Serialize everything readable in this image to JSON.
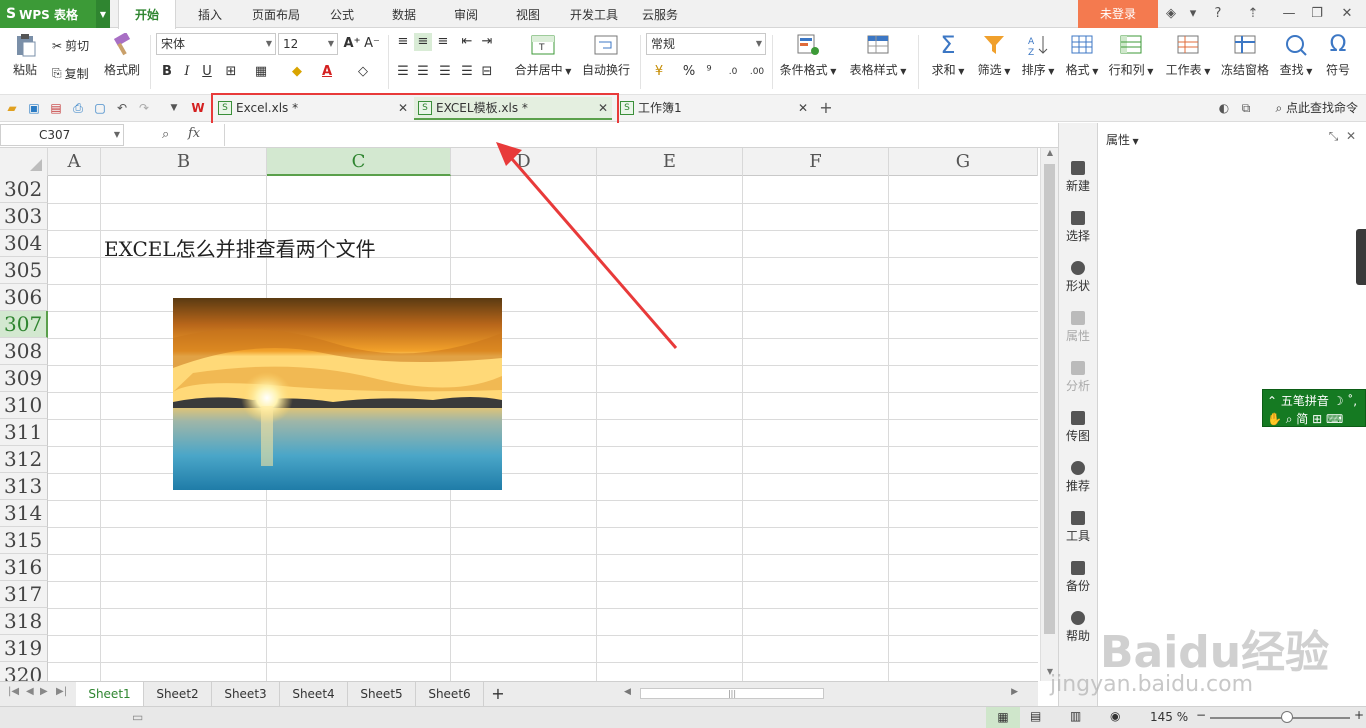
{
  "app": {
    "name": "WPS 表格",
    "login_label": "未登录",
    "help_label": "?"
  },
  "menu": {
    "tabs": [
      "开始",
      "插入",
      "页面布局",
      "公式",
      "数据",
      "审阅",
      "视图",
      "开发工具",
      "云服务"
    ],
    "active_tab": "开始"
  },
  "ribbon": {
    "paste": "粘贴",
    "cut": "剪切",
    "copy": "复制",
    "format_painter": "格式刷",
    "font_name": "宋体",
    "font_size": "12",
    "bold": "B",
    "italic": "I",
    "underline": "U",
    "merge_center": "合并居中",
    "wrap_text": "自动换行",
    "number_format": "常规",
    "percent": "%",
    "thousands": "⁹",
    "cond_format": "条件格式",
    "table_style": "表格样式",
    "sum": "求和",
    "filter": "筛选",
    "sort": "排序",
    "format": "格式",
    "row_col": "行和列",
    "worksheet": "工作表",
    "freeze": "冻结窗格",
    "find": "查找",
    "symbol": "符号"
  },
  "doc_tabs": [
    {
      "name": "Excel.xls *",
      "active": false
    },
    {
      "name": "EXCEL模板.xls *",
      "active": true
    },
    {
      "name": "工作簿1",
      "active": false
    }
  ],
  "find_command": "点此查找命令",
  "formula_bar": {
    "name_box": "C307",
    "fx": "fx",
    "value": ""
  },
  "grid": {
    "columns": [
      "A",
      "B",
      "C",
      "D",
      "E",
      "F",
      "G"
    ],
    "selected_column": "C",
    "rows": [
      "302",
      "303",
      "304",
      "305",
      "306",
      "307",
      "308",
      "309",
      "310",
      "311",
      "312",
      "313",
      "314",
      "315",
      "316",
      "317",
      "318",
      "319",
      "320"
    ],
    "selected_row": "307",
    "cell_text": "EXCEL怎么并排查看两个文件"
  },
  "sheets": {
    "tabs": [
      "Sheet1",
      "Sheet2",
      "Sheet3",
      "Sheet4",
      "Sheet5",
      "Sheet6"
    ],
    "active": "Sheet1",
    "add_label": "+"
  },
  "status": {
    "zoom": "145 %"
  },
  "task_pane": {
    "buttons": [
      "新建",
      "选择",
      "形状",
      "属性",
      "分析",
      "传图",
      "推荐",
      "工具",
      "备份",
      "帮助"
    ],
    "dimmed": [
      "属性",
      "分析"
    ],
    "title": "属性"
  },
  "ime": {
    "line1": "五笔拼音",
    "line2": "简"
  },
  "watermark": {
    "brand": "Baidu经验",
    "url": "jingyan.baidu.com"
  },
  "colors": {
    "accent_green": "#3c9a37",
    "login_orange": "#f47a4f",
    "highlight_red": "#e83a3a"
  }
}
